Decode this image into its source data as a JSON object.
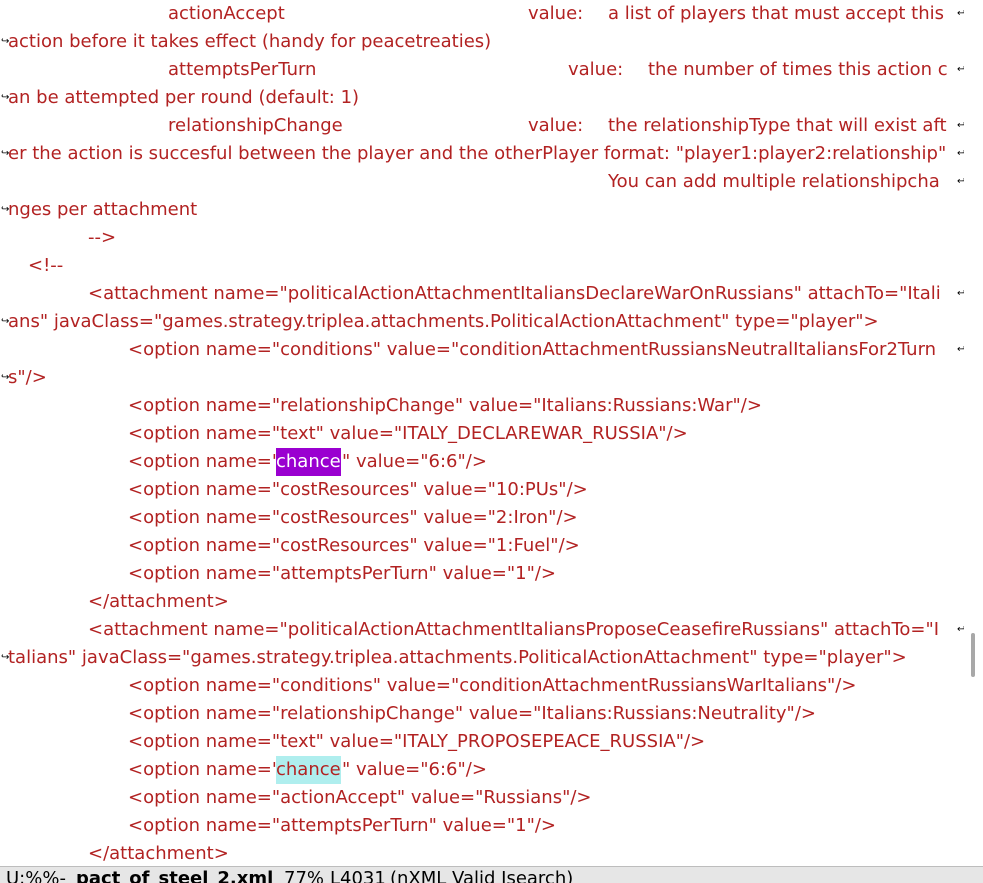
{
  "editor": {
    "lines": [
      {
        "segments": [
          "actionAccept",
          "value:",
          "a list of players that must accept this"
        ],
        "wrapped": true,
        "continued": false
      },
      {
        "segments": [
          "action before it takes effect (handy for peacetreaties)"
        ],
        "wrapped": false,
        "continued": true
      },
      {
        "segments": [
          "attemptsPerTurn",
          "value:",
          "the number of times this action c"
        ],
        "wrapped": true,
        "continued": false
      },
      {
        "segments": [
          "an be attempted per round (default: 1)"
        ],
        "wrapped": false,
        "continued": true
      },
      {
        "segments": [
          "relationshipChange",
          "value:",
          "the relationshipType that will exist aft"
        ],
        "wrapped": true,
        "continued": false
      },
      {
        "segments": [
          "er the action is succesful between the player and the otherPlayer format: \"player1:player2:relationship\""
        ],
        "wrapped": true,
        "continued": true
      },
      {
        "segments": [
          "You can add multiple relationshipcha"
        ],
        "wrapped": true,
        "continued": false
      },
      {
        "segments": [
          "nges per attachment"
        ],
        "wrapped": false,
        "continued": true
      },
      {
        "segments": [
          "-->"
        ],
        "wrapped": false,
        "continued": false
      },
      {
        "segments": [
          "<!--"
        ],
        "wrapped": false,
        "continued": false
      },
      {
        "segments": [
          "<attachment name=\"politicalActionAttachmentItaliansDeclareWarOnRussians\" attachTo=\"Itali"
        ],
        "wrapped": true,
        "continued": false
      },
      {
        "segments": [
          "ans\" javaClass=\"games.strategy.triplea.attachments.PoliticalActionAttachment\" type=\"player\">"
        ],
        "wrapped": false,
        "continued": true
      },
      {
        "segments": [
          "<option name=\"conditions\" value=\"conditionAttachmentRussiansNeutralItaliansFor2Turn"
        ],
        "wrapped": true,
        "continued": false
      },
      {
        "segments": [
          "s\"/>"
        ],
        "wrapped": false,
        "continued": true
      },
      {
        "segments": [
          "<option name=\"relationshipChange\" value=\"Italians:Russians:War\"/>"
        ],
        "wrapped": false,
        "continued": false
      },
      {
        "segments": [
          "<option name=\"text\" value=\"ITALY_DECLAREWAR_RUSSIA\"/>"
        ],
        "wrapped": false,
        "continued": false
      },
      {
        "segments": [
          "<option name=\"",
          "chance",
          "\" value=\"6:6\"/>"
        ],
        "wrapped": false,
        "continued": false
      },
      {
        "segments": [
          "<option name=\"costResources\" value=\"10:PUs\"/>"
        ],
        "wrapped": false,
        "continued": false
      },
      {
        "segments": [
          "<option name=\"costResources\" value=\"2:Iron\"/>"
        ],
        "wrapped": false,
        "continued": false
      },
      {
        "segments": [
          "<option name=\"costResources\" value=\"1:Fuel\"/>"
        ],
        "wrapped": false,
        "continued": false
      },
      {
        "segments": [
          "<option name=\"attemptsPerTurn\" value=\"1\"/>"
        ],
        "wrapped": false,
        "continued": false
      },
      {
        "segments": [
          "</attachment>"
        ],
        "wrapped": false,
        "continued": false
      },
      {
        "segments": [
          "<attachment name=\"politicalActionAttachmentItaliansProposeCeasefireRussians\" attachTo=\"I"
        ],
        "wrapped": true,
        "continued": false
      },
      {
        "segments": [
          "talians\" javaClass=\"games.strategy.triplea.attachments.PoliticalActionAttachment\" type=\"player\">"
        ],
        "wrapped": false,
        "continued": true
      },
      {
        "segments": [
          "<option name=\"conditions\" value=\"conditionAttachmentRussiansWarItalians\"/>"
        ],
        "wrapped": false,
        "continued": false
      },
      {
        "segments": [
          "<option name=\"relationshipChange\" value=\"Italians:Russians:Neutrality\"/>"
        ],
        "wrapped": false,
        "continued": false
      },
      {
        "segments": [
          "<option name=\"text\" value=\"ITALY_PROPOSEPEACE_RUSSIA\"/>"
        ],
        "wrapped": false,
        "continued": false
      },
      {
        "segments": [
          "<option name=\"",
          "chance",
          "\" value=\"6:6\"/>"
        ],
        "wrapped": false,
        "continued": false
      },
      {
        "segments": [
          "<option name=\"actionAccept\" value=\"Russians\"/>"
        ],
        "wrapped": false,
        "continued": false
      },
      {
        "segments": [
          "<option name=\"attemptsPerTurn\" value=\"1\"/>"
        ],
        "wrapped": false,
        "continued": false
      },
      {
        "segments": [
          "</attachment>"
        ],
        "wrapped": false,
        "continued": false
      }
    ],
    "highlights": [
      {
        "line": 16,
        "segment": 1,
        "style": "current-match",
        "color": "#9a00d0"
      },
      {
        "line": 27,
        "segment": 1,
        "style": "other-match",
        "color": "#afeeee"
      }
    ],
    "text_color": "#b22222",
    "fringe_wrap_glyph": "↩",
    "fringe_cont_glyph": "↪"
  },
  "scrollbar": {
    "position_fraction": 0.77,
    "visible_fraction": 0.05
  },
  "modeline": {
    "status": "U:%%-",
    "buffer_name": "pact_of_steel_2.xml",
    "percent": "77%",
    "line_number": "L4031",
    "modes": "(nXML Valid Isearch)"
  }
}
